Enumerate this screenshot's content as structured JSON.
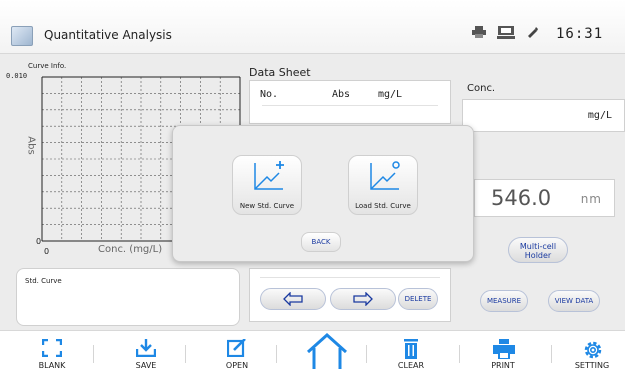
{
  "header": {
    "title": "Quantitative Analysis",
    "clock": "16:31"
  },
  "curve_info": {
    "label": "Curve Info.",
    "ymax": "0.010",
    "yzero": "0",
    "xzero": "0",
    "ylabel": "Abs",
    "xlabel": "Conc. (mg/L)"
  },
  "std_curve": {
    "label": "Std. Curve"
  },
  "data_sheet": {
    "title": "Data Sheet",
    "columns": [
      "No.",
      "Abs",
      "mg/L"
    ]
  },
  "pager": {
    "delete_label": "DELETE"
  },
  "conc": {
    "label": "Conc.",
    "unit": "mg/L"
  },
  "wavelength": {
    "value": "546.0",
    "unit": "nm"
  },
  "buttons": {
    "multi_line1": "Multi-cell",
    "multi_line2": "Holder",
    "measure": "MEASURE",
    "view_data": "VIEW DATA"
  },
  "dialog": {
    "new_label": "New Std. Curve",
    "load_label": "Load Std. Curve",
    "back_label": "BACK"
  },
  "bottom_bar": [
    {
      "label": "BLANK",
      "icon": "blank-icon"
    },
    {
      "label": "SAVE",
      "icon": "save-icon"
    },
    {
      "label": "OPEN",
      "icon": "open-icon"
    },
    {
      "label": "",
      "icon": "home-icon"
    },
    {
      "label": "CLEAR",
      "icon": "clear-icon"
    },
    {
      "label": "PRINT",
      "icon": "print-icon"
    },
    {
      "label": "SETTING",
      "icon": "gear-icon"
    }
  ],
  "colors": {
    "accent": "#1e88e5",
    "button_text": "#1a3aa0"
  }
}
